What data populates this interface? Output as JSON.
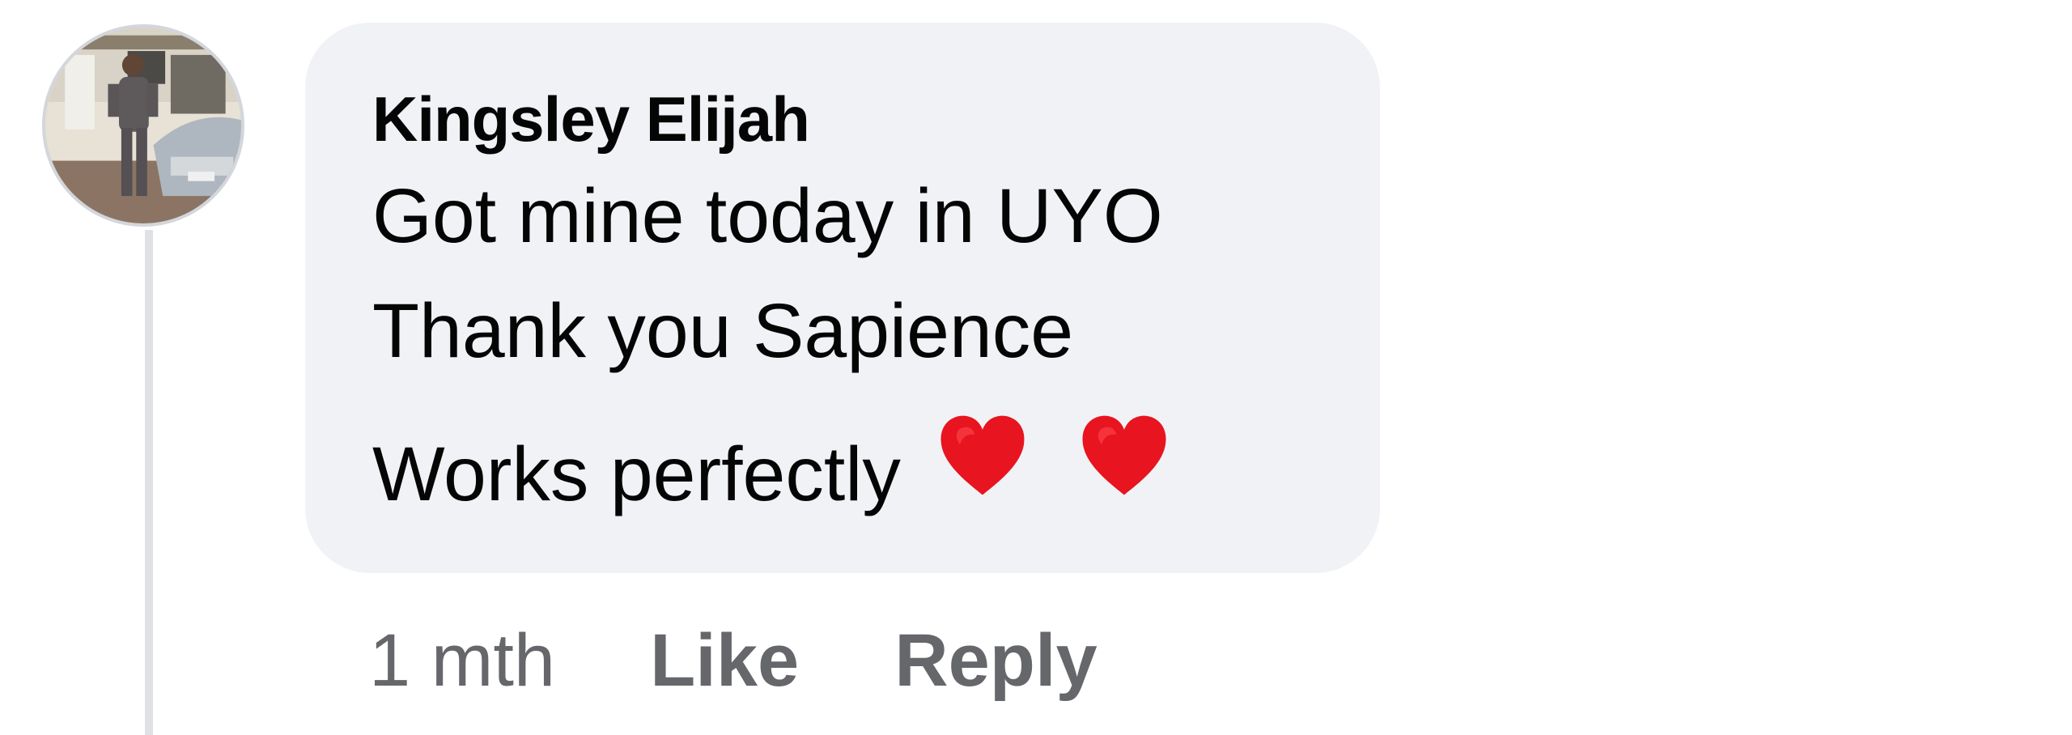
{
  "comment": {
    "author": "Kingsley Elijah",
    "lines": [
      "Got mine today in UYO",
      "Thank you Sapience",
      "Works perfectly"
    ],
    "emoji": [
      "red-heart",
      "red-heart"
    ],
    "timestamp": "1 mth",
    "actions": {
      "like_label": "Like",
      "reply_label": "Reply"
    }
  },
  "colors": {
    "bubble_background": "#f0f2f5",
    "text_primary": "#050505",
    "text_secondary": "#65676b",
    "heart": "#e8141f",
    "thread_line": "#dfe1e5"
  }
}
